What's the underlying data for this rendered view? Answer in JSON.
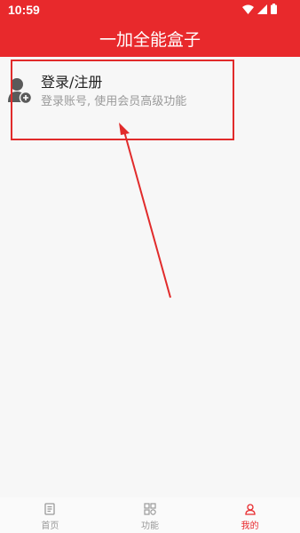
{
  "status_bar": {
    "time": "10:59"
  },
  "header": {
    "title": "一加全能盒子"
  },
  "account": {
    "title": "登录/注册",
    "subtitle": "登录账号, 使用会员高级功能"
  },
  "bottom_nav": {
    "items": [
      {
        "label": "首页",
        "icon": "document-icon",
        "active": false
      },
      {
        "label": "功能",
        "icon": "grid-icon",
        "active": false
      },
      {
        "label": "我的",
        "icon": "person-icon",
        "active": true
      }
    ]
  },
  "colors": {
    "brand": "#e8292c",
    "annotation": "#e12b2b"
  }
}
